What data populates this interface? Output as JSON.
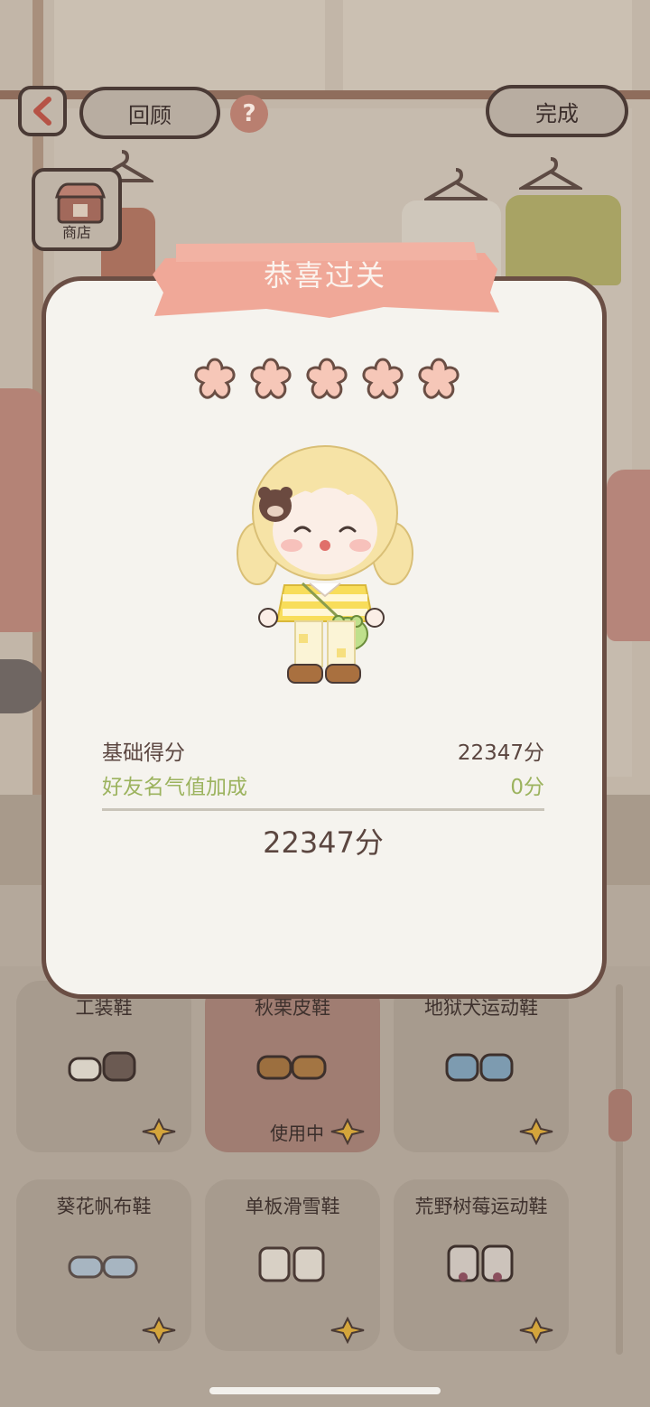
{
  "topbar": {
    "back_icon": "chevron-left-icon",
    "review_label": "回顾",
    "help_label": "?",
    "done_label": "完成"
  },
  "shop": {
    "label": "商店",
    "icon": "shop-stall-icon"
  },
  "modal": {
    "title": "恭喜过关",
    "rating": {
      "filled": 5,
      "max": 5
    },
    "base_score_label": "基础得分",
    "base_score_value": "22347分",
    "bonus_label": "好友名气值加成",
    "bonus_value": "0分",
    "total": "22347分"
  },
  "items": [
    {
      "name": "工装鞋",
      "status": "",
      "color": "#6b5a52"
    },
    {
      "name": "秋栗皮鞋",
      "status": "使用中",
      "color": "#7b5a3a"
    },
    {
      "name": "地狱犬运动鞋",
      "status": "",
      "color": "#6b7d8a"
    },
    {
      "name": "葵花帆布鞋",
      "status": "",
      "color": "#93a3b1"
    },
    {
      "name": "单板滑雪鞋",
      "status": "",
      "color": "#8a6f62"
    },
    {
      "name": "荒野树莓运动鞋",
      "status": "",
      "color": "#7a5d5a"
    }
  ],
  "colors": {
    "accent_pink": "#f0a898",
    "frame_brown": "#6a4e44",
    "bonus_green": "#9cb35e",
    "star_fill": "#f6c7b8"
  }
}
